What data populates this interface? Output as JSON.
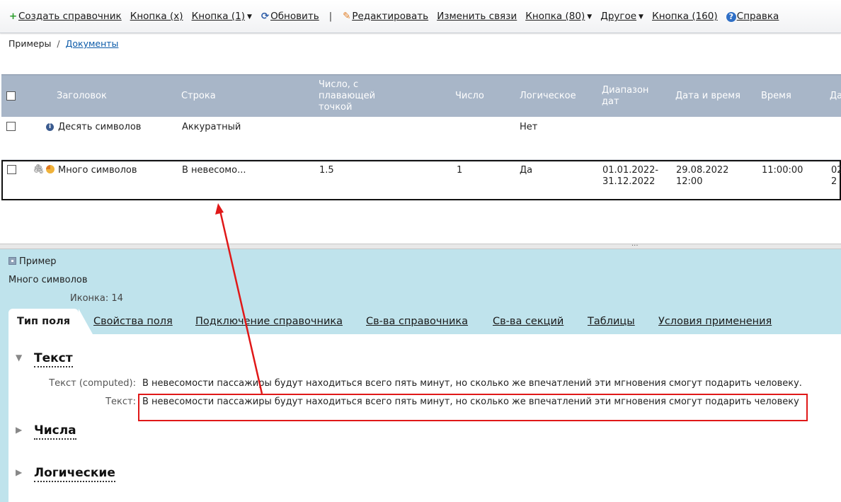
{
  "toolbar": {
    "items": [
      {
        "icon": "plus-icon",
        "glyph": "+",
        "color": "#2a9d2a",
        "label": "Создать справочник",
        "caret": false
      },
      {
        "icon": "",
        "glyph": "",
        "label": "Кнопка (x)",
        "caret": false
      },
      {
        "icon": "",
        "glyph": "",
        "label": "Кнопка (1)",
        "caret": true
      },
      {
        "icon": "refresh-icon",
        "glyph": "⟳",
        "color": "#2f5ea8",
        "label": "Обновить",
        "caret": false
      },
      {
        "icon": "pencil-icon",
        "glyph": "✎",
        "color": "#e07a1f",
        "label": "Редактировать",
        "caret": false
      },
      {
        "icon": "",
        "glyph": "",
        "label": "Изменить связи",
        "caret": false
      },
      {
        "icon": "",
        "glyph": "",
        "label": "Кнопка (80)",
        "caret": true
      },
      {
        "icon": "",
        "glyph": "",
        "label": "Другое",
        "caret": true
      },
      {
        "icon": "",
        "glyph": "",
        "label": "Кнопка (160)",
        "caret": false
      },
      {
        "icon": "help-icon",
        "glyph": "?",
        "color": "#2f6fc6",
        "label": "Справка",
        "caret": false
      }
    ],
    "separator": "|"
  },
  "breadcrumb": {
    "root": "Примеры",
    "separator": "/",
    "current": "Документы"
  },
  "table": {
    "columns": [
      "Заголовок",
      "Строка",
      "Число, с плавающей точкой",
      "Число",
      "Логическое",
      "Диапазон дат",
      "Дата и время",
      "Время",
      "Да"
    ],
    "rows": [
      {
        "title": "Десять символов",
        "string": "Аккуратный",
        "float": "",
        "number": "",
        "bool": "Нет",
        "date_range": "",
        "datetime": "",
        "time": "",
        "extra": "",
        "icon": "info-icon"
      },
      {
        "title": "Много символов",
        "string": "В невесомо...",
        "float": "1.5",
        "number": "1",
        "bool": "Да",
        "date_range": "01.01.2022-31.12.2022",
        "datetime": "29.08.2022 12:00",
        "time": "11:00:00",
        "extra": "02 2",
        "icon": "pie-icon",
        "attachment": true
      }
    ]
  },
  "splitter_grip": "...",
  "detail": {
    "type_label": "Пример",
    "name": "Много символов",
    "icon_label": "Иконка:",
    "icon_value": "14",
    "tabs": [
      "Тип поля",
      "Свойства поля",
      "Подключение справочника",
      "Св-ва справочника",
      "Св-ва секций",
      "Таблицы",
      "Условия применения"
    ],
    "active_tab": "Тип поля",
    "sections": [
      {
        "title": "Текст",
        "expanded": true,
        "fields": [
          {
            "label": "Текст (computed):",
            "value": "В невесомости пассажиры будут находиться всего пять минут, но сколько же впечатлений эти мгновения смогут подарить человеку."
          },
          {
            "label": "Текст:",
            "value": "В невесомости пассажиры будут находиться всего пять минут, но сколько же впечатлений эти мгновения смогут подарить человеку"
          }
        ]
      },
      {
        "title": "Числа",
        "expanded": false
      },
      {
        "title": "Логические",
        "expanded": false
      }
    ]
  },
  "colors": {
    "header_bg": "#a8b6c8",
    "panel_bg": "#bfe3ec",
    "annotation": "#e01818"
  }
}
